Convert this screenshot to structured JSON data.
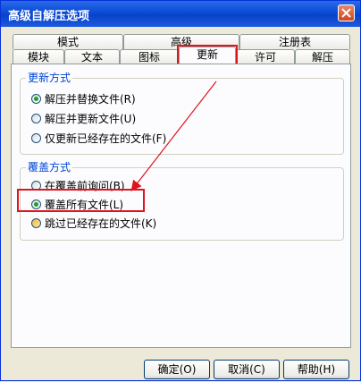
{
  "window": {
    "title": "高级自解压选项"
  },
  "tabs_top": [
    "模式",
    "高级",
    "注册表"
  ],
  "tabs_bottom": [
    "模块",
    "文本",
    "图标",
    "更新",
    "许可",
    "解压"
  ],
  "group_update": {
    "legend": "更新方式",
    "options": [
      "解压并替换文件(R)",
      "解压并更新文件(U)",
      "仅更新已经存在的文件(F)"
    ]
  },
  "group_overwrite": {
    "legend": "覆盖方式",
    "options": [
      "在覆盖前询问(B)",
      "覆盖所有文件(L)",
      "跳过已经存在的文件(K)"
    ]
  },
  "buttons": {
    "ok": "确定(O)",
    "cancel": "取消(C)",
    "help": "帮助(H)"
  },
  "colors": {
    "title_bar": "#0A4AD6",
    "highlight": "#E0141E",
    "legend": "#0046D5"
  }
}
